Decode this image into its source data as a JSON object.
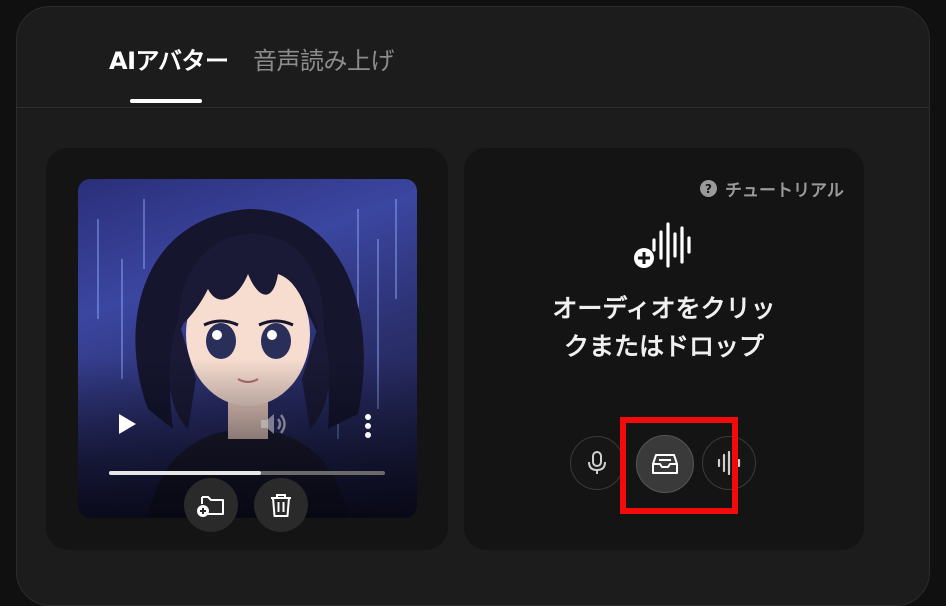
{
  "tabs": [
    {
      "label": "AIアバター",
      "active": true
    },
    {
      "label": "音声読み上げ",
      "active": false
    }
  ],
  "avatar_card": {
    "image_description": "anime-avatar-thumbnail",
    "progress_fraction": 0.55
  },
  "audio_card": {
    "tutorial_label": "チュートリアル",
    "help_glyph": "?",
    "drop_text": "オーディオをクリックまたはドロップ"
  },
  "icons": {
    "play": "play-icon",
    "volume": "volume-icon",
    "more": "more-vertical-icon",
    "folder_add": "folder-add-icon",
    "trash": "trash-icon",
    "audio_add": "audio-add-icon",
    "mic": "microphone-icon",
    "library": "inbox-icon",
    "waveform": "waveform-icon"
  },
  "colors": {
    "background": "#101010",
    "panel": "#1c1c1c",
    "card": "#141414",
    "highlight": "#f10b0b"
  }
}
